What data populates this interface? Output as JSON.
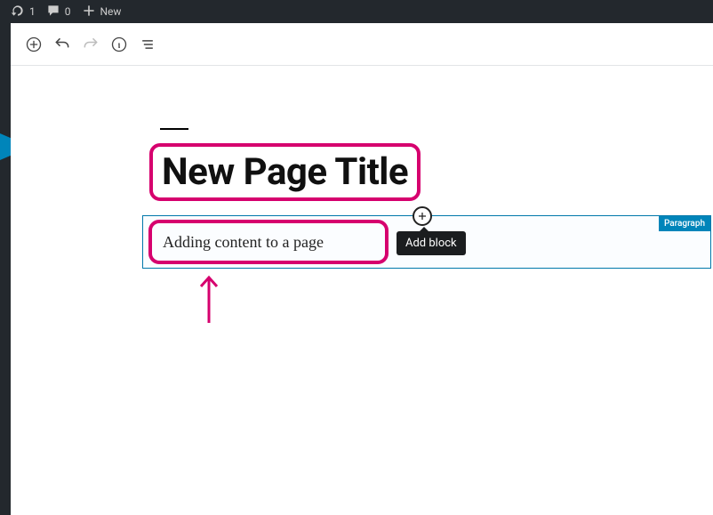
{
  "adminbar": {
    "updates_count": "1",
    "comments_count": "0",
    "new_label": "New"
  },
  "editor": {
    "title_text": "New Page Title",
    "paragraph_text": "Adding content to a page",
    "block_type_label": "Paragraph",
    "add_block_tooltip": "Add block"
  }
}
